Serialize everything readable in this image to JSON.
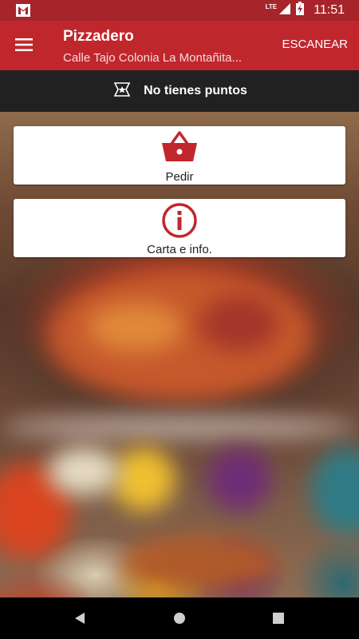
{
  "status_bar": {
    "time": "11:51",
    "network": "LTE"
  },
  "app_bar": {
    "title": "Pizzadero",
    "subtitle": "Calle Tajo Colonia La Montañita...",
    "scan_label": "ESCANEAR"
  },
  "points": {
    "text": "No tienes puntos"
  },
  "cards": [
    {
      "label": "Pedir",
      "icon": "basket-icon"
    },
    {
      "label": "Carta e info.",
      "icon": "info-icon"
    }
  ],
  "colors": {
    "primary": "#c0272d",
    "status_bar": "#a7252a",
    "points_bar": "#212121"
  }
}
